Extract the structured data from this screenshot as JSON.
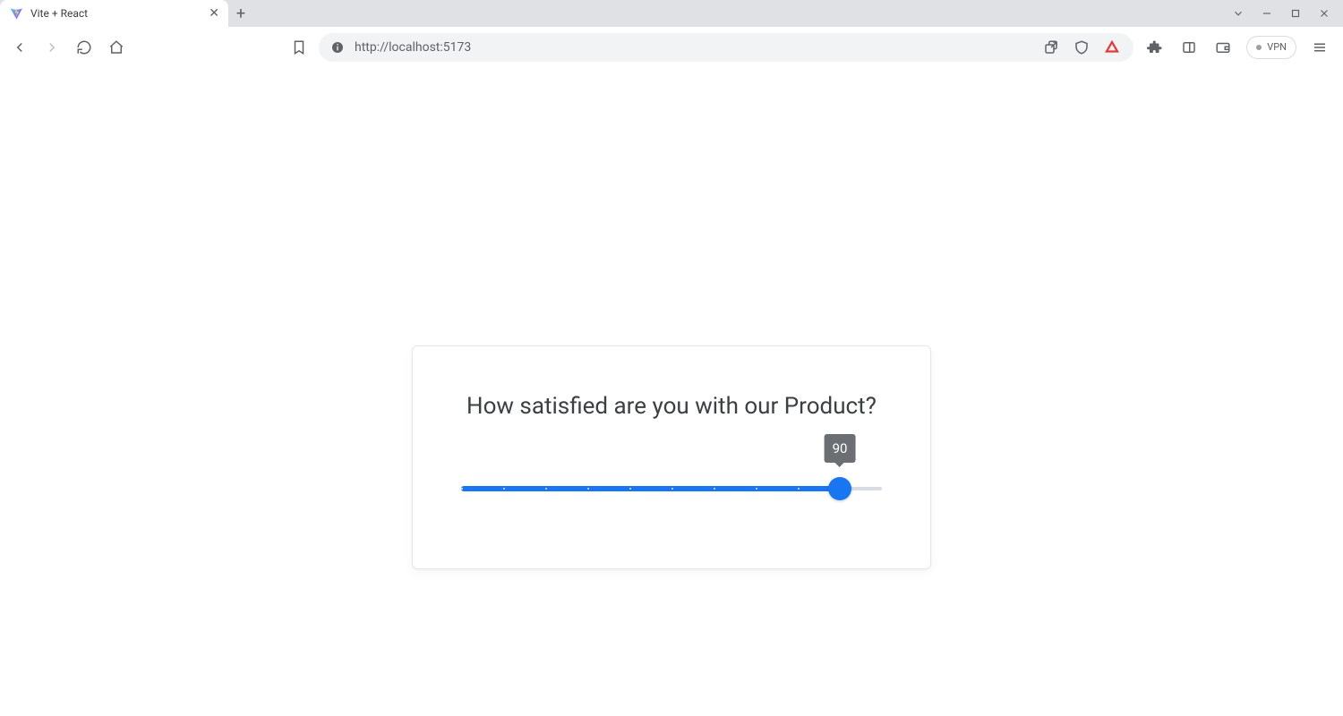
{
  "browser": {
    "tab_title": "Vite + React",
    "url": "http://localhost:5173",
    "vpn_label": "VPN"
  },
  "survey": {
    "question": "How satisfied are you with our Product?",
    "slider": {
      "min": 0,
      "max": 100,
      "step": 10,
      "value": 90,
      "tooltip": "90"
    }
  }
}
